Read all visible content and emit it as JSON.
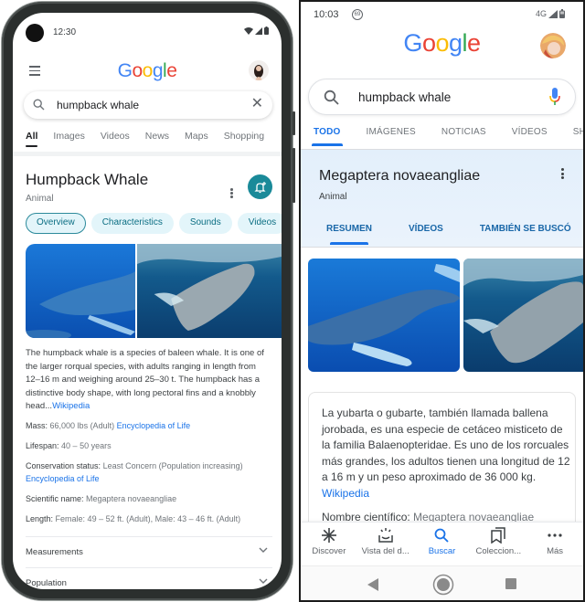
{
  "left_phone": {
    "status": {
      "time": "12:30"
    },
    "header": {
      "logo": [
        "G",
        "o",
        "o",
        "g",
        "l",
        "e"
      ]
    },
    "search": {
      "query": "humpback whale"
    },
    "tabs": [
      {
        "label": "All",
        "active": true
      },
      {
        "label": "Images"
      },
      {
        "label": "Videos"
      },
      {
        "label": "News"
      },
      {
        "label": "Maps"
      },
      {
        "label": "Shopping"
      }
    ],
    "knowledge_panel": {
      "title": "Humpback Whale",
      "subtitle": "Animal",
      "chips": [
        {
          "label": "Overview",
          "active": true
        },
        {
          "label": "Characteristics"
        },
        {
          "label": "Sounds"
        },
        {
          "label": "Videos"
        }
      ],
      "description": "The humpback whale is a species of baleen whale. It is one of the larger rorqual species, with adults ranging in length from 12–16 m and weighing around 25–30 t. The humpback has a distinctive body shape, with long pectoral fins and a knobbly head...",
      "description_source": "Wikipedia",
      "facts": [
        {
          "key": "Mass",
          "value": "66,000 lbs (Adult)",
          "source": "Encyclopedia of Life"
        },
        {
          "key": "Lifespan",
          "value": "40 – 50 years"
        },
        {
          "key": "Conservation status",
          "value": "Least Concern (Population increasing)",
          "source": "Encyclopedia of Life"
        },
        {
          "key": "Scientific name",
          "value": "Megaptera novaeangliae"
        },
        {
          "key": "Length",
          "value": "Female: 49 – 52 ft. (Adult), Male: 43 – 46 ft. (Adult)"
        }
      ],
      "sections": [
        {
          "label": "Measurements"
        },
        {
          "label": "Population"
        }
      ]
    }
  },
  "right_phone": {
    "status": {
      "time": "10:03",
      "badge": "69",
      "network": "4G"
    },
    "header": {
      "logo": [
        "G",
        "o",
        "o",
        "g",
        "l",
        "e"
      ]
    },
    "search": {
      "query": "humpback whale"
    },
    "tabs": [
      {
        "label": "TODO",
        "active": true
      },
      {
        "label": "IMÁGENES"
      },
      {
        "label": "NOTICIAS"
      },
      {
        "label": "VÍDEOS"
      },
      {
        "label": "SHO"
      }
    ],
    "knowledge_panel": {
      "title": "Megaptera novaeangliae",
      "subtitle": "Animal",
      "tabs": [
        {
          "label": "RESUMEN",
          "active": true
        },
        {
          "label": "VÍDEOS"
        },
        {
          "label": "TAMBIÉN SE BUSCÓ"
        }
      ],
      "description": "La yubarta o gubarte, también llamada ballena jorobada,  es una especie de cetáceo misticeto de la familia Balaenopteridae. Es uno de los rorcuales más grandes, los adultos tienen una longitud de 12 a 16 m y un peso aproximado de 36 000 kg.",
      "description_source": "Wikipedia",
      "scientific_name": {
        "key": "Nombre científico:",
        "value": "Megaptera novaeangliae"
      }
    },
    "bottom_nav": [
      {
        "label": "Discover",
        "icon": "asterisk-icon"
      },
      {
        "label": "Vista del d...",
        "icon": "sunrise-icon"
      },
      {
        "label": "Buscar",
        "icon": "search-icon",
        "active": true
      },
      {
        "label": "Coleccion...",
        "icon": "collections-icon"
      },
      {
        "label": "Más",
        "icon": "more-icon"
      }
    ]
  },
  "colors": {
    "google_blue": "#4285f4",
    "google_red": "#ea4335",
    "google_yellow": "#fbbc05",
    "google_green": "#34a853",
    "link": "#1a73e8",
    "follow_button": "#1a8a99",
    "chip_bg": "#e3f5fa"
  }
}
